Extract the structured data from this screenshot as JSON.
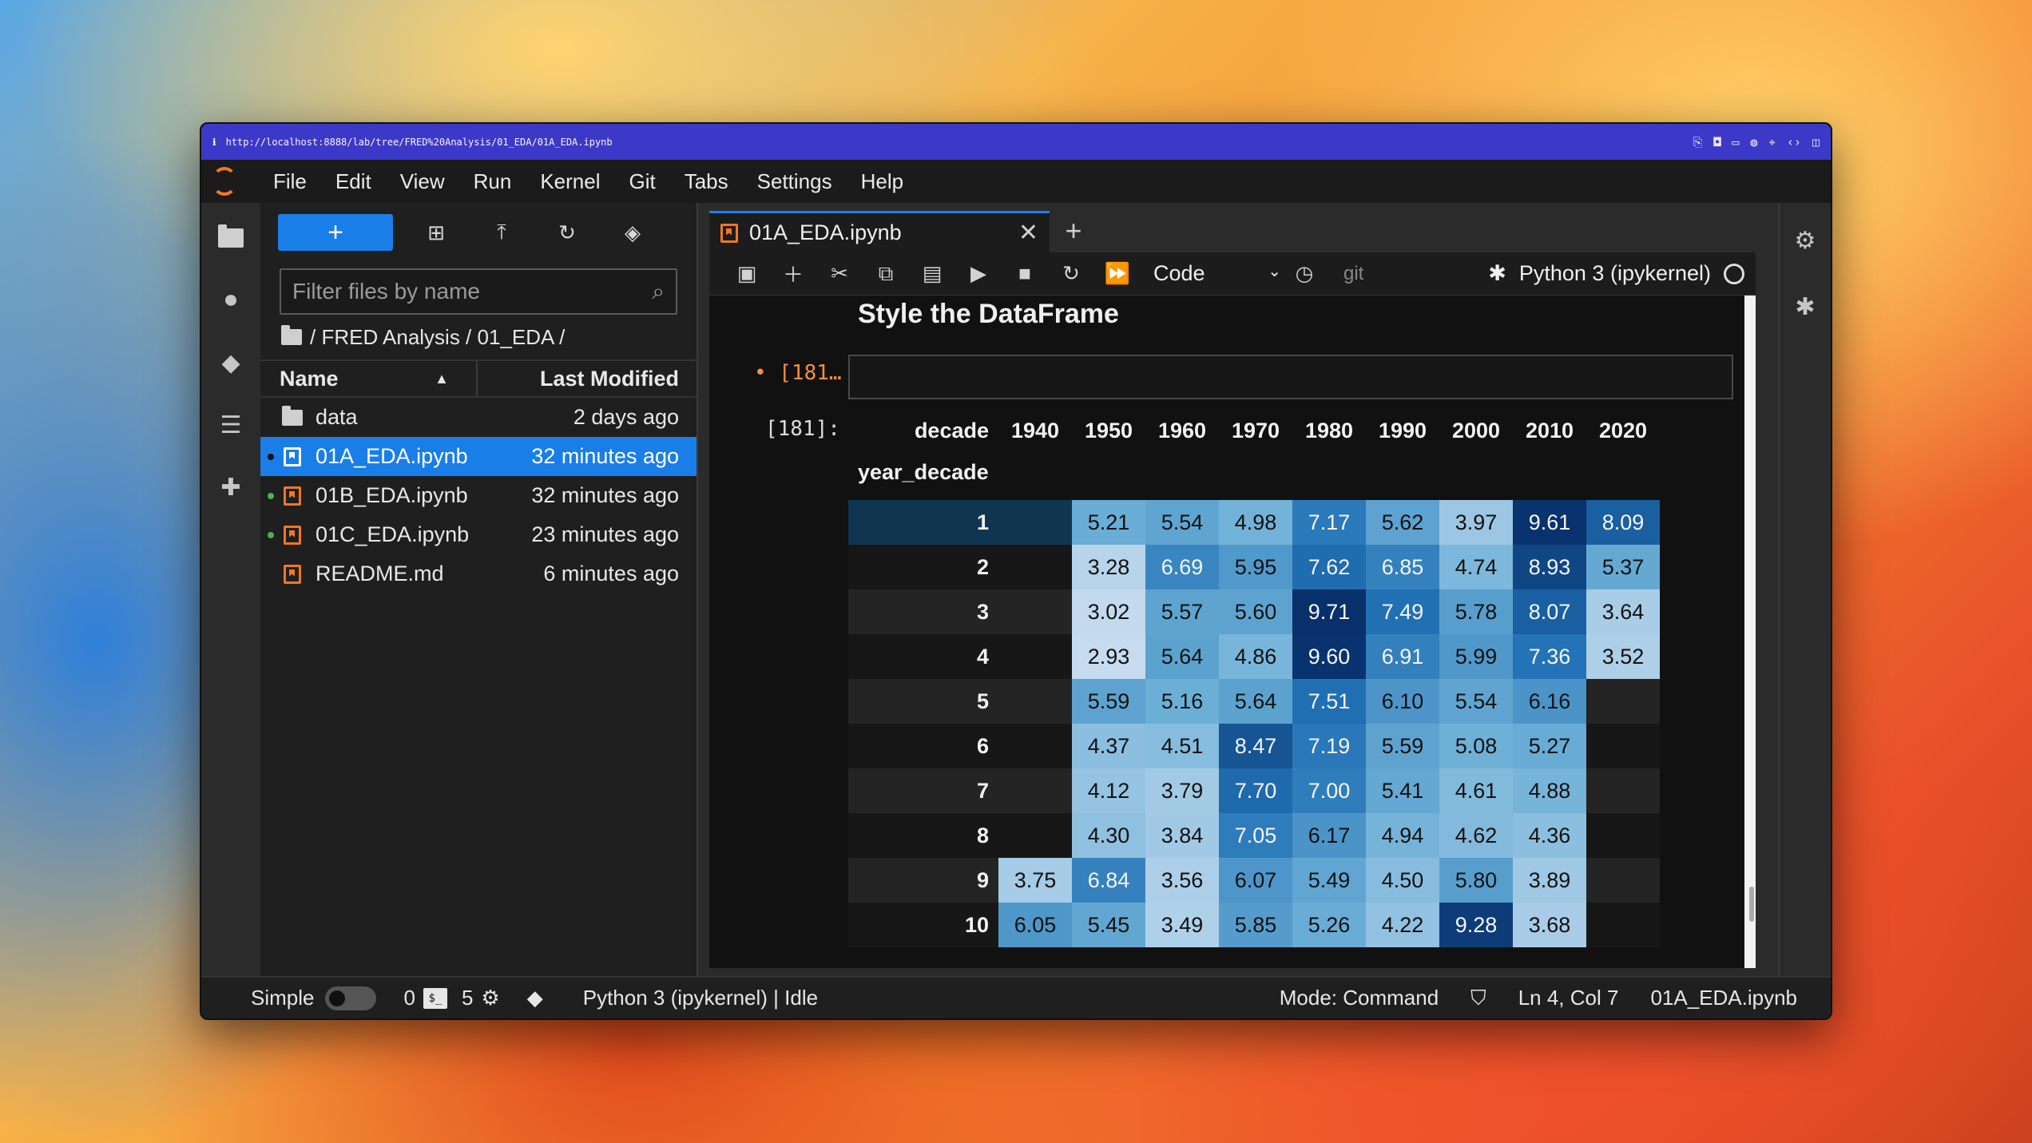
{
  "browser": {
    "url": "http://localhost:8888/lab/tree/FRED%20Analysis/01_EDA/01A_EDA.ipynb"
  },
  "menu": [
    "File",
    "Edit",
    "View",
    "Run",
    "Kernel",
    "Git",
    "Tabs",
    "Settings",
    "Help"
  ],
  "filebrowser": {
    "new_label": "+",
    "filter_placeholder": "Filter files by name",
    "breadcrumb": "/ FRED Analysis / 01_EDA /",
    "col_name": "Name",
    "col_modified": "Last Modified",
    "files": [
      {
        "name": "data",
        "modified": "2 days ago",
        "type": "folder",
        "running": false,
        "selected": false
      },
      {
        "name": "01A_EDA.ipynb",
        "modified": "32 minutes ago",
        "type": "notebook",
        "running": true,
        "selected": true
      },
      {
        "name": "01B_EDA.ipynb",
        "modified": "32 minutes ago",
        "type": "notebook",
        "running": true,
        "selected": false
      },
      {
        "name": "01C_EDA.ipynb",
        "modified": "23 minutes ago",
        "type": "notebook",
        "running": true,
        "selected": false
      },
      {
        "name": "README.md",
        "modified": "6 minutes ago",
        "type": "markdown",
        "running": false,
        "selected": false
      }
    ]
  },
  "notebook": {
    "tab_title": "01A_EDA.ipynb",
    "cell_type": "Code",
    "git_label": "git",
    "kernel": "Python 3 (ipykernel)",
    "heading": "Style the DataFrame",
    "input_prompt": "• [181…",
    "output_prompt": "[181]:",
    "df": {
      "columns_name": "decade",
      "index_name": "year_decade",
      "columns": [
        "1940",
        "1950",
        "1960",
        "1970",
        "1980",
        "1990",
        "2000",
        "2010",
        "2020"
      ],
      "rows": [
        {
          "index": "1",
          "values": [
            "",
            "5.21",
            "5.54",
            "4.98",
            "7.17",
            "5.62",
            "3.97",
            "9.61",
            "8.09"
          ]
        },
        {
          "index": "2",
          "values": [
            "",
            "3.28",
            "6.69",
            "5.95",
            "7.62",
            "6.85",
            "4.74",
            "8.93",
            "5.37"
          ]
        },
        {
          "index": "3",
          "values": [
            "",
            "3.02",
            "5.57",
            "5.60",
            "9.71",
            "7.49",
            "5.78",
            "8.07",
            "3.64"
          ]
        },
        {
          "index": "4",
          "values": [
            "",
            "2.93",
            "5.64",
            "4.86",
            "9.60",
            "6.91",
            "5.99",
            "7.36",
            "3.52"
          ]
        },
        {
          "index": "5",
          "values": [
            "",
            "5.59",
            "5.16",
            "5.64",
            "7.51",
            "6.10",
            "5.54",
            "6.16",
            ""
          ]
        },
        {
          "index": "6",
          "values": [
            "",
            "4.37",
            "4.51",
            "8.47",
            "7.19",
            "5.59",
            "5.08",
            "5.27",
            ""
          ]
        },
        {
          "index": "7",
          "values": [
            "",
            "4.12",
            "3.79",
            "7.70",
            "7.00",
            "5.41",
            "4.61",
            "4.88",
            ""
          ]
        },
        {
          "index": "8",
          "values": [
            "",
            "4.30",
            "3.84",
            "7.05",
            "6.17",
            "4.94",
            "4.62",
            "4.36",
            ""
          ]
        },
        {
          "index": "9",
          "values": [
            "3.75",
            "6.84",
            "3.56",
            "6.07",
            "5.49",
            "4.50",
            "5.80",
            "3.89",
            ""
          ]
        },
        {
          "index": "10",
          "values": [
            "6.05",
            "5.45",
            "3.49",
            "5.85",
            "5.26",
            "4.22",
            "9.28",
            "3.68",
            ""
          ]
        }
      ],
      "colormap": [
        "#c6dbef",
        "#08306b"
      ]
    }
  },
  "statusbar": {
    "simple_label": "Simple",
    "terminals": "0",
    "kernels": "5",
    "kernel_status": "Python 3 (ipykernel) | Idle",
    "mode": "Mode: Command",
    "cursor": "Ln 4, Col 7",
    "filename": "01A_EDA.ipynb"
  },
  "colors": {
    "accent": "#1a7ee8",
    "jupyter_orange": "#f37626",
    "url_bar": "#3d39c8"
  }
}
